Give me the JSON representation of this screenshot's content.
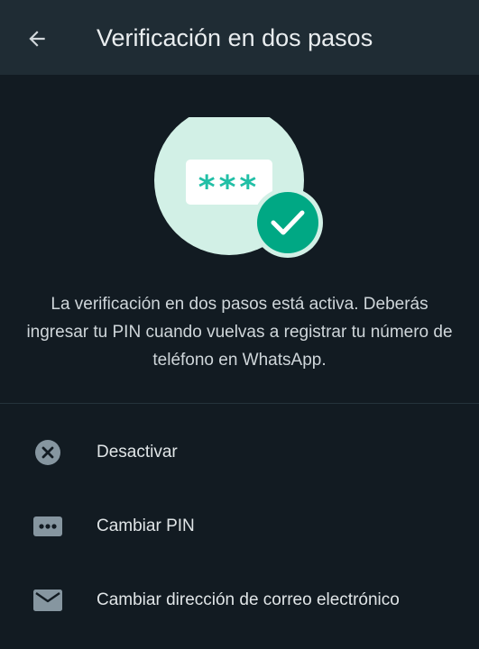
{
  "header": {
    "title": "Verificación en dos pasos",
    "back_icon": "arrow-left-icon"
  },
  "illustration": {
    "pin_mask": "***",
    "status_icon": "check-icon",
    "colors": {
      "circle": "#d2f0e6",
      "card": "#ffffff",
      "accent": "#21bfa6",
      "badge": "#00a884"
    }
  },
  "description": {
    "text": "La verificación en dos pasos está activa. Deberás ingresar tu PIN cuando vuelvas a registrar tu número de teléfono en WhatsApp."
  },
  "menu": {
    "items": [
      {
        "label": "Desactivar",
        "icon": "close-circle-icon"
      },
      {
        "label": "Cambiar PIN",
        "icon": "pin-dots-icon"
      },
      {
        "label": "Cambiar dirección de correo electrónico",
        "icon": "email-icon"
      }
    ]
  },
  "colors": {
    "background": "#121b22",
    "header": "#1f2c34",
    "text_primary": "#e9edef",
    "icon": "#8696a0"
  }
}
